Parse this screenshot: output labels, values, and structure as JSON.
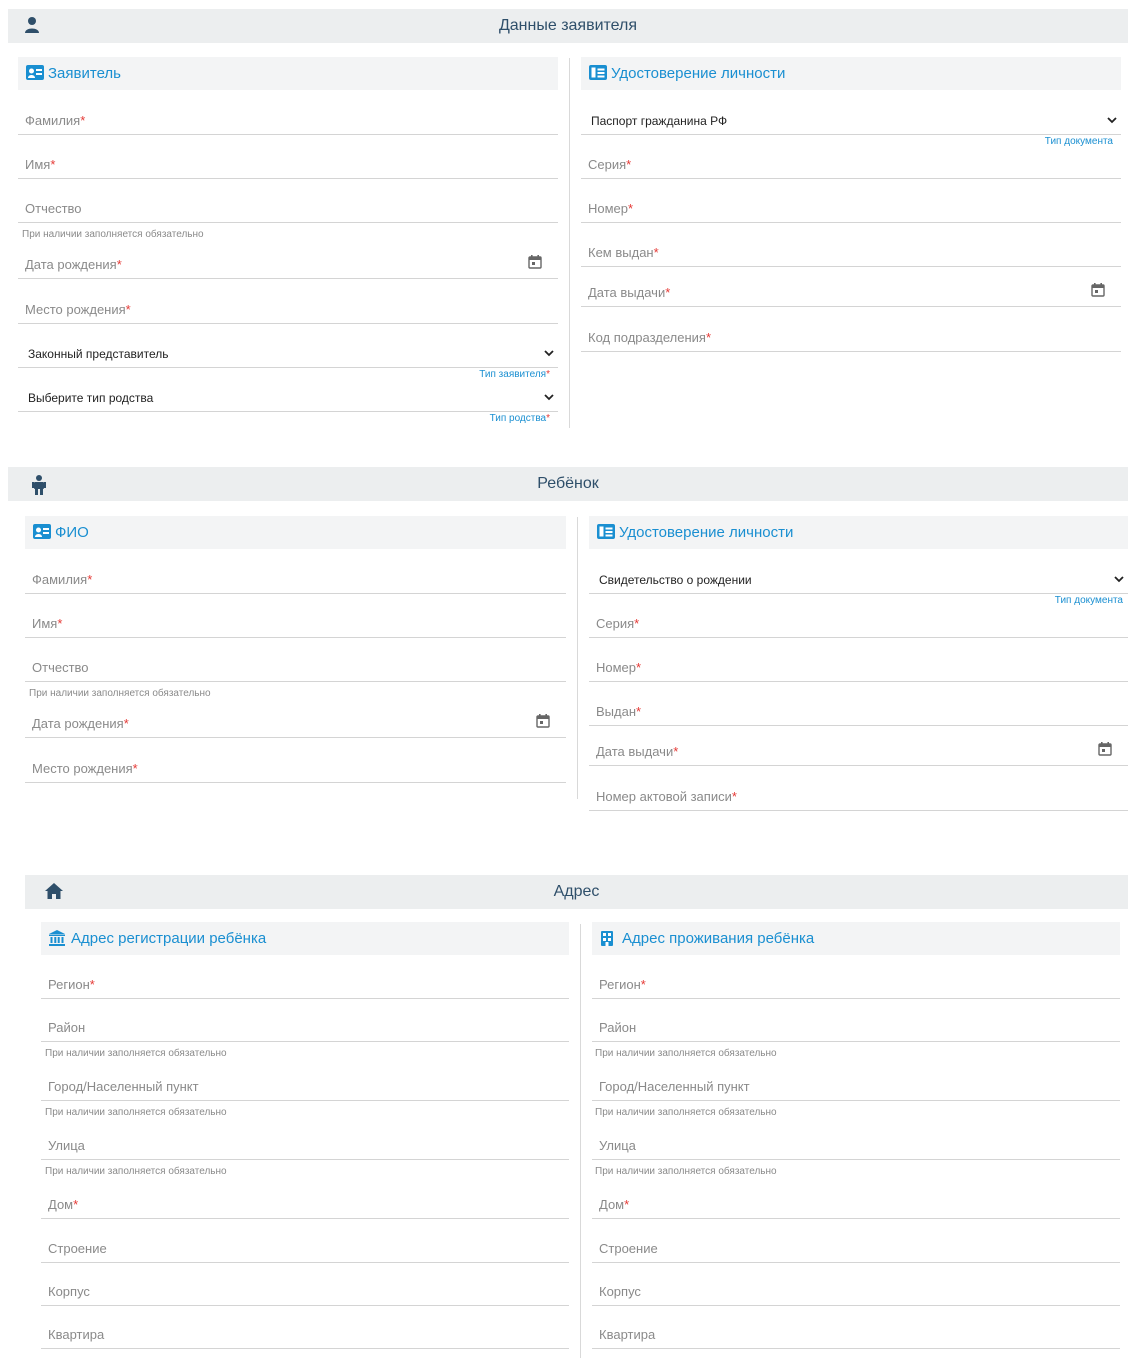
{
  "applicant_section": {
    "title": "Данные заявителя",
    "applicant": {
      "title": "Заявитель",
      "last_name": "Фамилия",
      "first_name": "Имя",
      "patronymic": "Отчество",
      "patronymic_hint": "При наличии заполняется обязательно",
      "birth_date": "Дата рождения",
      "birth_place": "Место рождения",
      "applicant_type_value": "Законный представитель",
      "applicant_type_label": "Тип заявителя",
      "kinship_value": "Выберите тип родства",
      "kinship_label": "Тип родства"
    },
    "id_doc": {
      "title": "Удостоверение личности",
      "doc_type_value": "Паспорт гражданина РФ",
      "doc_type_label": "Тип документа",
      "series": "Серия",
      "number": "Номер",
      "issued_by": "Кем выдан",
      "issue_date": "Дата выдачи",
      "division_code": "Код подразделения"
    }
  },
  "child_section": {
    "title": "Ребёнок",
    "fio": {
      "title": "ФИО",
      "last_name": "Фамилия",
      "first_name": "Имя",
      "patronymic": "Отчество",
      "patronymic_hint": "При наличии заполняется обязательно",
      "birth_date": "Дата рождения",
      "birth_place": "Место рождения"
    },
    "id_doc": {
      "title": "Удостоверение личности",
      "doc_type_value": "Свидетельство о рождении",
      "doc_type_label": "Тип документа",
      "series": "Серия",
      "number": "Номер",
      "issued": "Выдан",
      "issue_date": "Дата выдачи",
      "record_number": "Номер актовой записи"
    }
  },
  "address_section": {
    "title": "Адрес",
    "registration": {
      "title": "Адрес регистрации ребёнка",
      "region": "Регион",
      "district": "Район",
      "district_hint": "При наличии заполняется обязательно",
      "city": "Город/Населенный пункт",
      "city_hint": "При наличии заполняется обязательно",
      "street": "Улица",
      "street_hint": "При наличии заполняется обязательно",
      "house": "Дом",
      "building": "Строение",
      "block": "Корпус",
      "apartment": "Квартира"
    },
    "residence": {
      "title": "Адрес проживания ребёнка",
      "region": "Регион",
      "district": "Район",
      "district_hint": "При наличии заполняется обязательно",
      "city": "Город/Населенный пункт",
      "city_hint": "При наличии заполняется обязательно",
      "street": "Улица",
      "street_hint": "При наличии заполняется обязательно",
      "house": "Дом",
      "building": "Строение",
      "block": "Корпус",
      "apartment": "Квартира"
    }
  },
  "required_mark": "*",
  "icons": {
    "applicant": "person-icon",
    "child": "child-icon",
    "address": "home-icon",
    "id_card": "id-card-icon",
    "passport": "passport-icon",
    "bank": "bank-icon",
    "building": "building-icon",
    "calendar": "calendar-icon",
    "dropdown": "chevron-down-icon"
  },
  "colors": {
    "accent": "#1a8fd1",
    "header_text": "#2f4f6a",
    "required": "#e53935",
    "bar_bg": "#eceeef"
  }
}
